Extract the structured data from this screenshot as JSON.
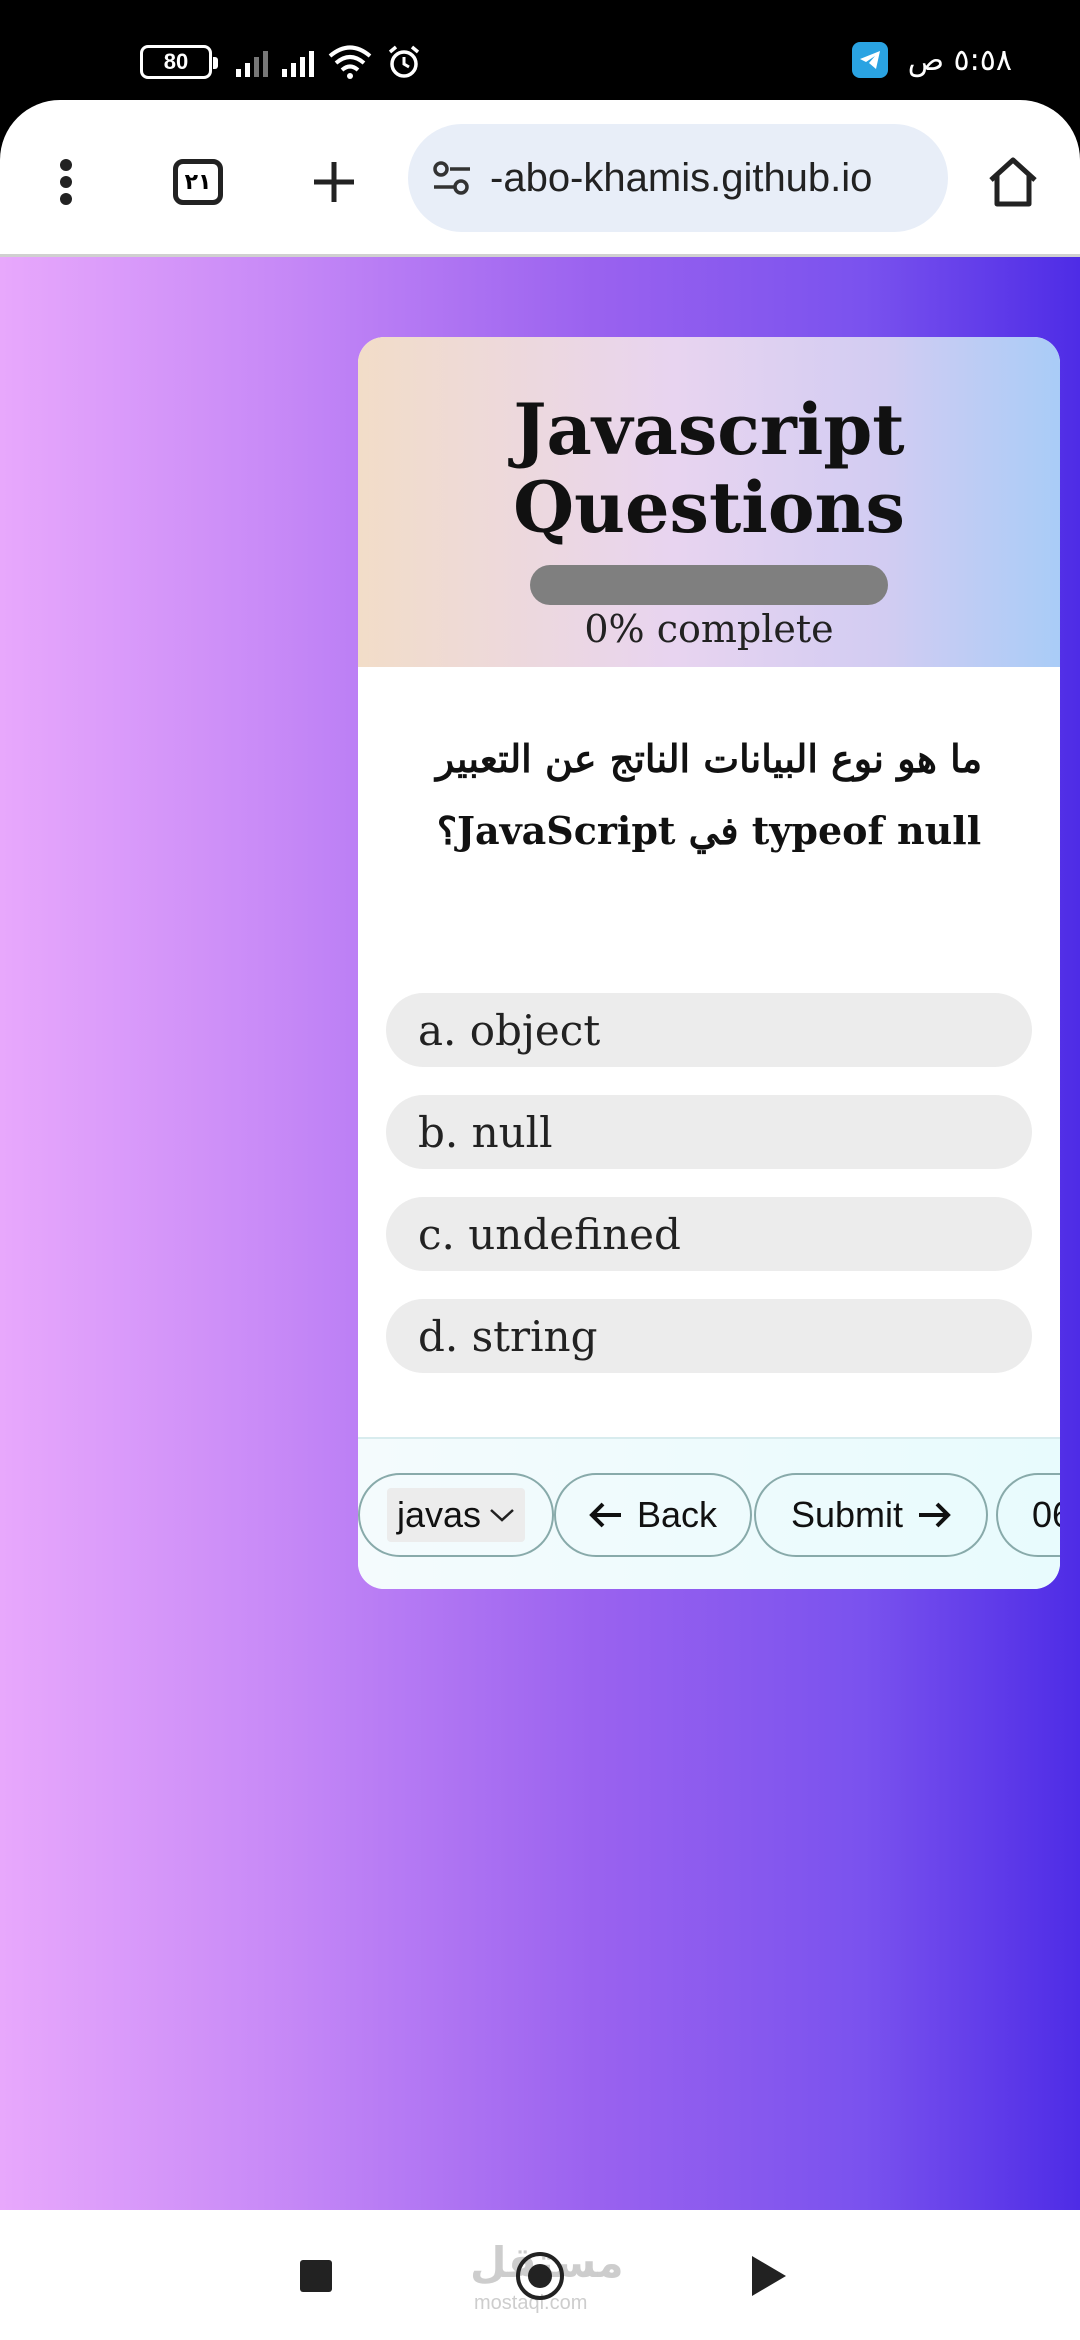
{
  "status_bar": {
    "battery": "80",
    "time": "٥:٥٨ ص"
  },
  "browser": {
    "tabs_count": "٢١",
    "url": "-abo-khamis.github.io"
  },
  "quiz": {
    "title_line1": "Javascript",
    "title_line2": "Questions",
    "progress_percent": 0,
    "progress_label": "0% complete",
    "question_line1": "ما هو نوع البيانات الناتج عن التعبير",
    "question_line2": "typeof null في JavaScript؟",
    "options": [
      {
        "label": "a. object"
      },
      {
        "label": "b. null"
      },
      {
        "label": "c. undefined"
      },
      {
        "label": "d. string"
      }
    ]
  },
  "footer": {
    "category_select": "javas",
    "back_label": "Back",
    "submit_label": "Submit",
    "timer_partial": "06"
  },
  "watermark": {
    "text": "مستقل",
    "sub": "mostaql.com"
  },
  "colors": {
    "progress_track": "#7f7f7f",
    "option_bg": "#ececec",
    "page_gradient_start": "#e8a8fc",
    "page_gradient_end": "#4e2ce6"
  }
}
